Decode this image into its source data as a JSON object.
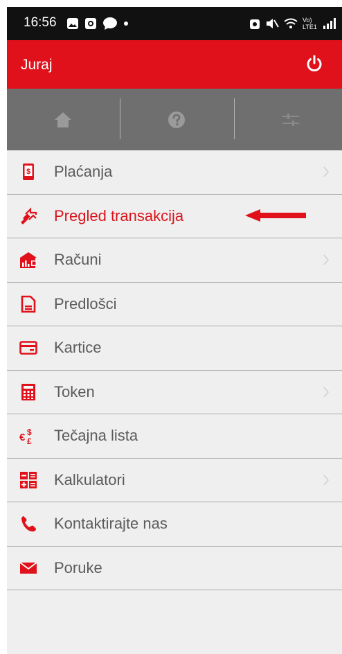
{
  "status_bar": {
    "time": "16:56",
    "network_label": "Vo) LTE1"
  },
  "app_bar": {
    "user_name": "Juraj",
    "power_icon": "power-icon"
  },
  "toolbar": {
    "buttons": [
      {
        "icon": "home-icon"
      },
      {
        "icon": "help-icon"
      },
      {
        "icon": "sliders-icon"
      }
    ]
  },
  "menu": {
    "items": [
      {
        "label": "Plaćanja",
        "icon": "payments-icon",
        "has_chevron": true,
        "active": false
      },
      {
        "label": "Pregled transakcija",
        "icon": "transactions-icon",
        "has_chevron": false,
        "active": true
      },
      {
        "label": "Računi",
        "icon": "accounts-icon",
        "has_chevron": true,
        "active": false
      },
      {
        "label": "Predlošci",
        "icon": "templates-icon",
        "has_chevron": false,
        "active": false
      },
      {
        "label": "Kartice",
        "icon": "cards-icon",
        "has_chevron": false,
        "active": false
      },
      {
        "label": "Token",
        "icon": "token-icon",
        "has_chevron": true,
        "active": false
      },
      {
        "label": "Tečajna lista",
        "icon": "exchange-rates-icon",
        "has_chevron": false,
        "active": false
      },
      {
        "label": "Kalkulatori",
        "icon": "calculators-icon",
        "has_chevron": true,
        "active": false
      },
      {
        "label": "Kontaktirajte nas",
        "icon": "phone-icon",
        "has_chevron": false,
        "active": false
      },
      {
        "label": "Poruke",
        "icon": "envelope-icon",
        "has_chevron": false,
        "active": false
      }
    ]
  },
  "colors": {
    "brand_red": "#e0111a",
    "text_gray": "#5b5b5b",
    "toolbar_gray": "#6f6f6f",
    "background": "#efefef"
  }
}
